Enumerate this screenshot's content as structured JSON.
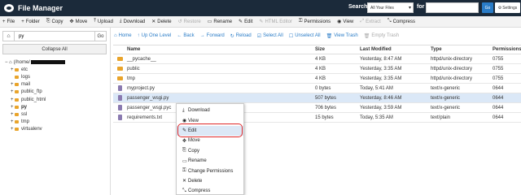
{
  "header": {
    "title": "File Manager",
    "search_label": "Search",
    "search_scope": "All Your Files",
    "for_label": "for",
    "go_label": "Go",
    "settings_label": "Settings"
  },
  "toolbar": [
    {
      "label": "File",
      "icon": "plus-icon",
      "glyph": "+",
      "enabled": true
    },
    {
      "label": "Folder",
      "icon": "plus-icon",
      "glyph": "+",
      "enabled": true
    },
    {
      "label": "Copy",
      "icon": "copy-icon",
      "glyph": "⎘",
      "enabled": true
    },
    {
      "label": "Move",
      "icon": "move-icon",
      "glyph": "✥",
      "enabled": true
    },
    {
      "label": "Upload",
      "icon": "upload-icon",
      "glyph": "⤒",
      "enabled": true
    },
    {
      "label": "Download",
      "icon": "download-icon",
      "glyph": "⤓",
      "enabled": true
    },
    {
      "label": "Delete",
      "icon": "delete-icon",
      "glyph": "✕",
      "enabled": true
    },
    {
      "label": "Restore",
      "icon": "restore-icon",
      "glyph": "↺",
      "enabled": false
    },
    {
      "label": "Rename",
      "icon": "rename-icon",
      "glyph": "▭",
      "enabled": true
    },
    {
      "label": "Edit",
      "icon": "edit-icon",
      "glyph": "✎",
      "enabled": true
    },
    {
      "label": "HTML Editor",
      "icon": "html-editor-icon",
      "glyph": "✎",
      "enabled": false
    },
    {
      "label": "Permissions",
      "icon": "permissions-icon",
      "glyph": "⚿",
      "enabled": true
    },
    {
      "label": "View",
      "icon": "view-icon",
      "glyph": "◉",
      "enabled": true
    },
    {
      "label": "Extract",
      "icon": "extract-icon",
      "glyph": "⤢",
      "enabled": false
    },
    {
      "label": "Compress",
      "icon": "compress-icon",
      "glyph": "⤡",
      "enabled": true
    }
  ],
  "sidebar": {
    "path_value": "py",
    "go_label": "Go",
    "collapse_label": "Collapse All",
    "tree_root": "(/home/",
    "tree": [
      {
        "label": "etc",
        "expand": true,
        "bold": false
      },
      {
        "label": "logs",
        "expand": false,
        "bold": false
      },
      {
        "label": "mail",
        "expand": true,
        "bold": false
      },
      {
        "label": "public_ftp",
        "expand": true,
        "bold": false
      },
      {
        "label": "public_html",
        "expand": true,
        "bold": false
      },
      {
        "label": "py",
        "expand": true,
        "bold": true
      },
      {
        "label": "ssl",
        "expand": true,
        "bold": false
      },
      {
        "label": "tmp",
        "expand": true,
        "bold": false
      },
      {
        "label": "virtualenv",
        "expand": true,
        "bold": false
      }
    ]
  },
  "nav": [
    {
      "label": "Home",
      "icon": "home-icon",
      "glyph": "⌂",
      "enabled": true
    },
    {
      "label": "Up One Level",
      "icon": "up-level-icon",
      "glyph": "↑",
      "enabled": true
    },
    {
      "label": "Back",
      "icon": "back-icon",
      "glyph": "←",
      "enabled": true
    },
    {
      "label": "Forward",
      "icon": "forward-icon",
      "glyph": "→",
      "enabled": true
    },
    {
      "label": "Reload",
      "icon": "reload-icon",
      "glyph": "↻",
      "enabled": true
    },
    {
      "label": "Select All",
      "icon": "select-all-icon",
      "glyph": "☑",
      "enabled": true
    },
    {
      "label": "Unselect All",
      "icon": "unselect-all-icon",
      "glyph": "☐",
      "enabled": true
    },
    {
      "label": "View Trash",
      "icon": "trash-icon",
      "glyph": "🗑",
      "enabled": true
    },
    {
      "label": "Empty Trash",
      "icon": "empty-trash-icon",
      "glyph": "🗑",
      "enabled": false
    }
  ],
  "table": {
    "headers": [
      "Name",
      "Size",
      "Last Modified",
      "Type",
      "Permissions"
    ],
    "rows": [
      {
        "kind": "folder",
        "name": "__pycache__",
        "size": "4 KB",
        "modified": "Yesterday, 8:47 AM",
        "type": "httpd/unix-directory",
        "perms": "0755",
        "selected": false
      },
      {
        "kind": "folder",
        "name": "public",
        "size": "4 KB",
        "modified": "Yesterday, 3:35 AM",
        "type": "httpd/unix-directory",
        "perms": "0755",
        "selected": false
      },
      {
        "kind": "folder",
        "name": "tmp",
        "size": "4 KB",
        "modified": "Yesterday, 3:35 AM",
        "type": "httpd/unix-directory",
        "perms": "0755",
        "selected": false
      },
      {
        "kind": "file",
        "name": "myproject.py",
        "size": "0 bytes",
        "modified": "Today, 5:41 AM",
        "type": "text/x-generic",
        "perms": "0644",
        "selected": false
      },
      {
        "kind": "file",
        "name": "passenger_wsgi.py",
        "size": "507 bytes",
        "modified": "Yesterday, 8:46 AM",
        "type": "text/x-generic",
        "perms": "0644",
        "selected": true
      },
      {
        "kind": "file",
        "name": "passenger_wsgi.pyc",
        "size": "706 bytes",
        "modified": "Yesterday, 3:59 AM",
        "type": "text/x-generic",
        "perms": "0644",
        "selected": false
      },
      {
        "kind": "file",
        "name": "requirements.txt",
        "size": "15 bytes",
        "modified": "Today, 5:35 AM",
        "type": "text/plain",
        "perms": "0644",
        "selected": false
      }
    ]
  },
  "context_menu": [
    {
      "label": "Download",
      "icon": "download-icon",
      "glyph": "⤓"
    },
    {
      "label": "View",
      "icon": "view-icon",
      "glyph": "◉"
    },
    {
      "label": "Edit",
      "icon": "edit-icon",
      "glyph": "✎"
    },
    {
      "label": "Move",
      "icon": "move-icon",
      "glyph": "✥"
    },
    {
      "label": "Copy",
      "icon": "copy-icon",
      "glyph": "⎘"
    },
    {
      "label": "Rename",
      "icon": "rename-icon",
      "glyph": "▭"
    },
    {
      "label": "Change Permissions",
      "icon": "permissions-icon",
      "glyph": "⚿"
    },
    {
      "label": "Delete",
      "icon": "delete-icon",
      "glyph": "✕"
    },
    {
      "label": "Compress",
      "icon": "compress-icon",
      "glyph": "⤡"
    }
  ],
  "highlighted_menu_index": 2,
  "colors": {
    "header_bg": "#1b2a3a",
    "accent": "#2a7cc7",
    "folder": "#e9a42b",
    "highlight": "#e02828",
    "selected_row": "#dbe8f7"
  }
}
